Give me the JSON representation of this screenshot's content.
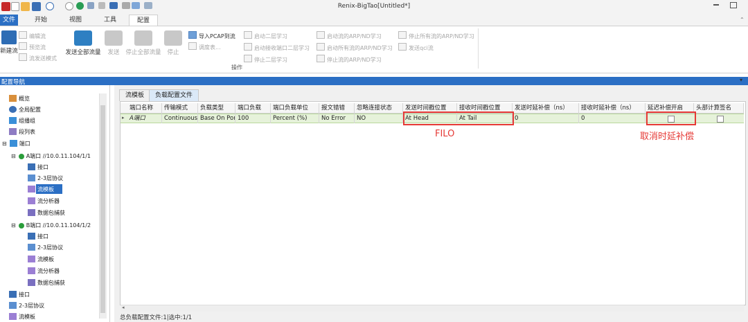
{
  "window": {
    "title": "Renix-BigTao[Untitled*]"
  },
  "ribbon_tabs": [
    "文件",
    "开始",
    "视图",
    "工具",
    "配置"
  ],
  "ribbon": {
    "new_stream": "新建流",
    "edit_stream": "编辑流",
    "preview_stream": "预览流",
    "stream_send_mode": "流发送模式",
    "send_all": "发送全部流量",
    "send": "发送",
    "stop_all": "停止全部流量",
    "stop": "停止",
    "import_pcap": "导入PCAP到流",
    "schedule_table": "调度表...",
    "start_l2_learning": "启动二层学习",
    "start_rx_l2_learning": "启动接收端口二层学习",
    "stop_l2_learning": "停止二层学习",
    "start_arp_nd": "启动流的ARP/ND学习",
    "start_all_arp_nd": "启动所有流的ARP/ND学习",
    "stop_arp_nd": "停止流的ARP/ND学习",
    "stop_all_arp_nd": "停止所有流的ARP/ND学习",
    "send_qci": "发送qci流",
    "group_label": "操作"
  },
  "nav": {
    "title": "配置导航",
    "items": [
      {
        "label": "概览"
      },
      {
        "label": "全局配置"
      },
      {
        "label": "组播组"
      },
      {
        "label": "段列表"
      },
      {
        "label": "端口"
      },
      {
        "label": "A端口 //10.0.11.104/1/1"
      },
      {
        "label": "接口"
      },
      {
        "label": "2-3层协议"
      },
      {
        "label": "流模板"
      },
      {
        "label": "流分析器"
      },
      {
        "label": "数据包捕获"
      },
      {
        "label": "B端口 //10.0.11.104/1/2"
      },
      {
        "label": "接口"
      },
      {
        "label": "2-3层协议"
      },
      {
        "label": "流模板"
      },
      {
        "label": "流分析器"
      },
      {
        "label": "数据包捕获"
      },
      {
        "label": "接口"
      },
      {
        "label": "2-3层协议"
      },
      {
        "label": "流模板"
      }
    ]
  },
  "main_tabs": [
    "流模板",
    "负载配置文件"
  ],
  "table": {
    "headers": [
      "端口名称",
      "传输模式",
      "负载类型",
      "端口负载",
      "端口负载单位",
      "报文错错",
      "忽略连接状态",
      "发送时间戳位置",
      "接收时间戳位置",
      "发送时延补偿（ns）",
      "接收时延补偿（ns）",
      "延迟补偿开启",
      "头部计算签名"
    ],
    "row": [
      "A端口",
      "Continuous",
      "Base On Port",
      "100",
      "Percent (%)",
      "No Error",
      "NO",
      "At Head",
      "At Tail",
      "0",
      "0"
    ]
  },
  "annotations": {
    "filo": "FILO",
    "cancel_comp": "取消时延补偿"
  },
  "status": "总负载配置文件:1|选中:1/1",
  "colors": {
    "accent": "#2b6fc4",
    "row_highlight": "#e6f2da",
    "annotation_red": "#e53935"
  }
}
